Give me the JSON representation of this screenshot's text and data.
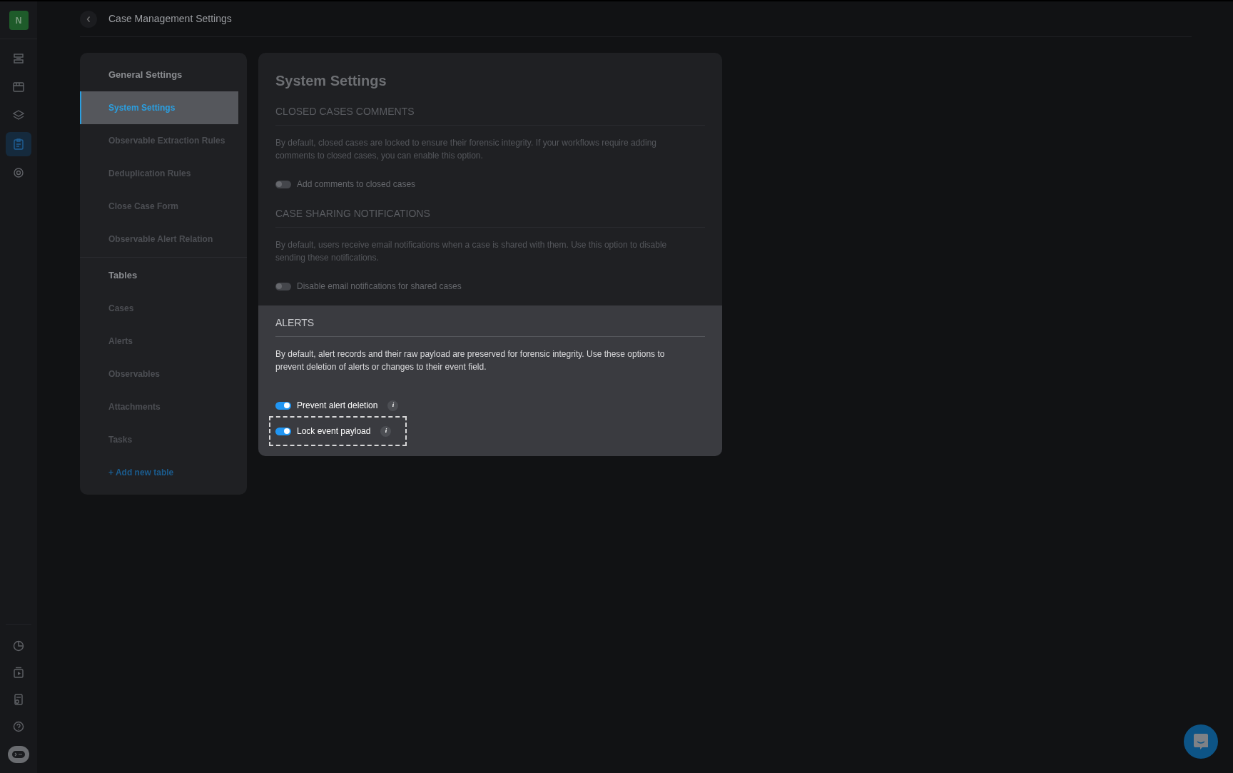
{
  "app_rail": {
    "avatar": "N",
    "top_items": [
      {
        "selected": false
      },
      {
        "selected": false
      },
      {
        "selected": false
      },
      {
        "selected": true
      },
      {
        "selected": false
      }
    ],
    "bottom_items": [
      {
        "selected": false
      },
      {
        "selected": false
      },
      {
        "selected": false
      },
      {
        "selected": false
      }
    ]
  },
  "header": {
    "title": "Case Management Settings"
  },
  "nav": {
    "groups": [
      {
        "heading": "General Settings",
        "items": [
          {
            "label": "System Settings",
            "selected": true
          },
          {
            "label": "Observable Extraction Rules",
            "selected": false
          },
          {
            "label": "Deduplication Rules",
            "selected": false
          },
          {
            "label": "Close Case Form",
            "selected": false
          },
          {
            "label": "Observable Alert Relation",
            "selected": false
          }
        ]
      },
      {
        "heading": "Tables",
        "items": [
          {
            "label": "Cases",
            "selected": false
          },
          {
            "label": "Alerts",
            "selected": false
          },
          {
            "label": "Observables",
            "selected": false
          },
          {
            "label": "Attachments",
            "selected": false
          },
          {
            "label": "Tasks",
            "selected": false
          }
        ]
      }
    ],
    "add_link": "+ Add new table"
  },
  "content": {
    "title": "System Settings",
    "sections": [
      {
        "heading": "CLOSED CASES COMMENTS",
        "highlighted": false,
        "description": "By default, closed cases are locked to ensure their forensic integrity. If your workflows require adding comments to closed cases, you can enable this option.",
        "options": [
          {
            "label": "Add comments to closed cases",
            "on": false,
            "focused": false
          }
        ]
      },
      {
        "heading": "CASE SHARING NOTIFICATIONS",
        "highlighted": false,
        "description": "By default, users receive email notifications when a case is shared with them. Use this option to disable sending these notifications.",
        "options": [
          {
            "label": "Disable email notifications for shared cases",
            "on": false,
            "focused": false
          }
        ]
      },
      {
        "heading": "ALERTS",
        "highlighted": true,
        "description": "By default, alert records and their raw payload are preserved for forensic integrity. Use these options to prevent deletion of alerts or changes to their event field.",
        "options": [
          {
            "label": "Prevent alert deletion",
            "on": true,
            "focused": false,
            "info": "i"
          },
          {
            "label": "Lock event payload",
            "on": true,
            "focused": true,
            "info": "i"
          }
        ]
      }
    ]
  }
}
